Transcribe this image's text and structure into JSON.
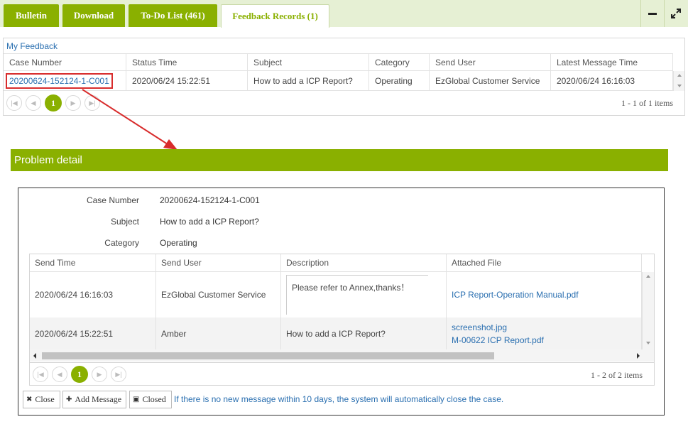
{
  "tabs": [
    {
      "label": "Bulletin"
    },
    {
      "label": "Download"
    },
    {
      "label": "To-Do List (461)"
    },
    {
      "label": "Feedback Records (1)"
    }
  ],
  "feedback": {
    "title": "My Feedback",
    "columns": [
      "Case Number",
      "Status Time",
      "Subject",
      "Category",
      "Send User",
      "Latest Message Time"
    ],
    "row": {
      "case_number": "20200624-152124-1-C001",
      "status_time": "2020/06/24 15:22:51",
      "subject": "How to add a ICP Report?",
      "category": "Operating",
      "send_user": "EzGlobal Customer Service",
      "latest_message_time": "2020/06/24 16:16:03"
    },
    "current_page": "1",
    "page_info": "1 - 1 of 1 items"
  },
  "detail": {
    "header": "Problem detail",
    "labels": {
      "case_number": "Case Number",
      "subject": "Subject",
      "category": "Category"
    },
    "values": {
      "case_number": "20200624-152124-1-C001",
      "subject": "How to add a ICP Report?",
      "category": "Operating"
    },
    "columns": [
      "Send Time",
      "Send User",
      "Description",
      "Attached File"
    ],
    "messages": [
      {
        "send_time": "2020/06/24 16:16:03",
        "send_user": "EzGlobal Customer Service",
        "description": "Please refer to Annex,thanks！",
        "files": [
          "ICP Report-Operation Manual.pdf"
        ]
      },
      {
        "send_time": "2020/06/24 15:22:51",
        "send_user": "Amber",
        "description": "How to add a ICP Report?",
        "files": [
          "screenshot.jpg",
          "M-00622 ICP Report.pdf"
        ]
      }
    ],
    "current_page": "1",
    "page_info": "1 - 2 of 2 items",
    "buttons": {
      "close": "Close",
      "add_message": "Add Message",
      "closed": "Closed"
    },
    "notice": "If there is no new message within 10 days, the system will automatically close the case."
  },
  "colors": {
    "accent": "#8ab000",
    "link": "#2a6fb0",
    "highlight": "#d82c2c"
  }
}
